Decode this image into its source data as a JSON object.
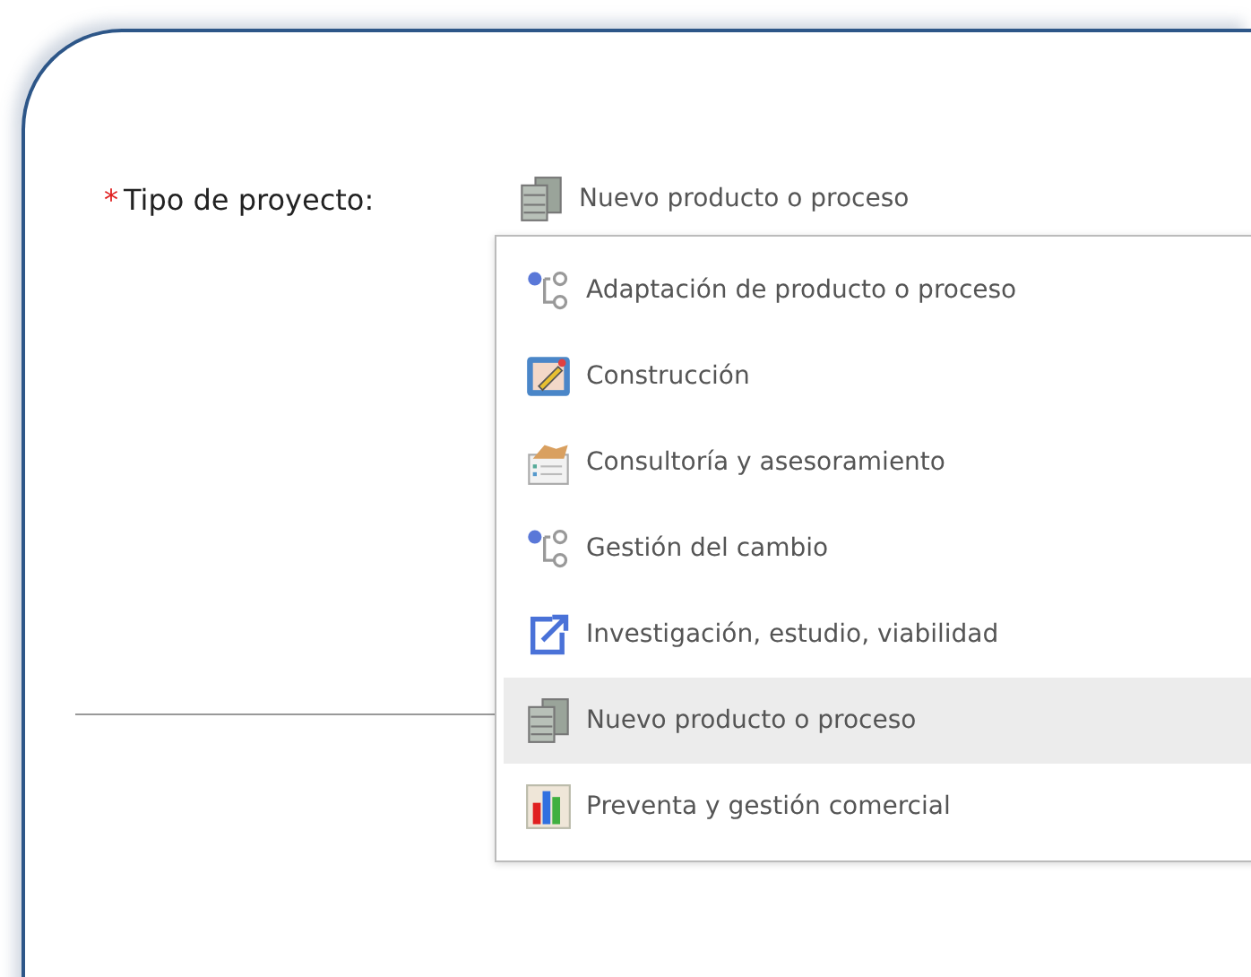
{
  "field": {
    "required_mark": "*",
    "label": "Tipo de proyecto:",
    "value": {
      "kind": "servers",
      "label": "Nuevo producto o proceso"
    }
  },
  "dropdown": {
    "options": [
      {
        "kind": "flow",
        "label": "Adaptación de producto o proceso",
        "selected": false
      },
      {
        "kind": "construction",
        "label": "Construcción",
        "selected": false
      },
      {
        "kind": "handshake",
        "label": "Consultoría y asesoramiento",
        "selected": false
      },
      {
        "kind": "flow",
        "label": "Gestión del cambio",
        "selected": false
      },
      {
        "kind": "external",
        "label": "Investigación, estudio, viabilidad",
        "selected": false
      },
      {
        "kind": "servers",
        "label": "Nuevo producto o proceso",
        "selected": true
      },
      {
        "kind": "chart",
        "label": "Preventa y gestión comercial",
        "selected": false
      }
    ]
  }
}
